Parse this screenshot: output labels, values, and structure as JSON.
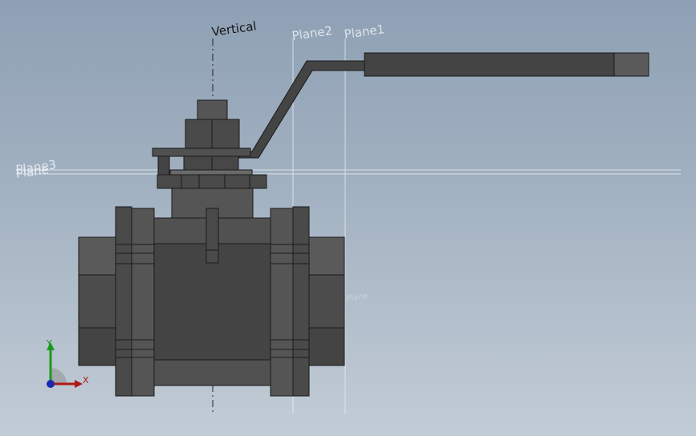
{
  "viewport": {
    "background_top": "#8ea0b4",
    "background_bottom": "#c2ccd6"
  },
  "reference_planes": {
    "vertical_axis": "Vertical",
    "plane1": "Plane1",
    "plane2": "Plane2",
    "plane3_overlap": "Plane3",
    "plane_under": "Plane",
    "plane_faint": "Plane"
  },
  "triad": {
    "x_label": "X",
    "y_label": "Y",
    "x_color": "#b01818",
    "y_color": "#1a9a1a",
    "z_color": "#1a2ab0"
  },
  "model": {
    "name": "ball-valve",
    "body_color": "#474747",
    "edge_color": "#1a1a1a"
  }
}
